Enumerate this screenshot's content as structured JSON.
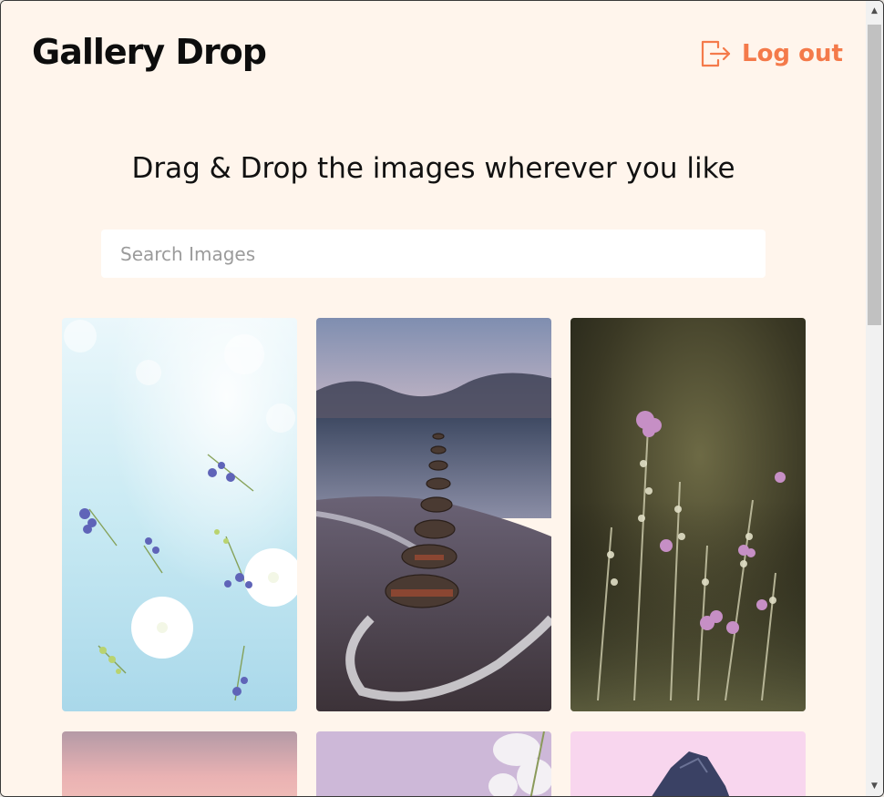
{
  "header": {
    "brand": "Gallery Drop",
    "logout_label": "Log out",
    "logout_icon": "logout-icon",
    "accent": "#f47a4a"
  },
  "main": {
    "subtitle": "Drag & Drop the images wherever you like",
    "search": {
      "placeholder": "Search Images",
      "value": ""
    }
  },
  "gallery": {
    "images": [
      {
        "subject": "blue-hydrangea-and-lavender-flowers"
      },
      {
        "subject": "wooden-breakwater-posts-on-beach"
      },
      {
        "subject": "heather-wildflowers"
      },
      {
        "subject": "pink-sunset-sky"
      },
      {
        "subject": "lavender-sky-with-white-blossom"
      },
      {
        "subject": "pink-sky-with-dark-rock"
      }
    ]
  }
}
